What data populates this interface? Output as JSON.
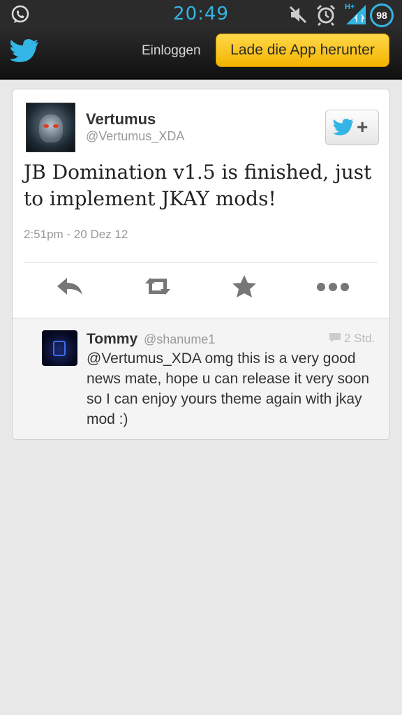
{
  "status_bar": {
    "time": "20:49",
    "network_label": "H+",
    "battery": "98",
    "accent_color": "#33b5e5",
    "icons": [
      "whatsapp-icon",
      "mute-icon",
      "alarm-icon",
      "signal-icon",
      "battery-icon"
    ]
  },
  "header": {
    "login_label": "Einloggen",
    "app_button_label": "Lade die App herunter",
    "brand_color": "#33b5e5",
    "button_color": "#f8c420"
  },
  "tweet": {
    "author_name": "Vertumus",
    "author_handle": "@Vertumus_XDA",
    "follow_label": "+",
    "text": "JB Domination v1.5 is finished, just to implement JKAY mods!",
    "timestamp": "2:51pm - 20 Dez 12",
    "actions": [
      "reply-icon",
      "retweet-icon",
      "favorite-icon",
      "more-icon"
    ]
  },
  "reply": {
    "author_name": "Tommy",
    "author_handle": "@shanume1",
    "age": "2 Std.",
    "text": "@Vertumus_XDA omg this is a very good news mate, hope u can release it very soon so I can enjoy yours theme again with jkay mod :)"
  }
}
